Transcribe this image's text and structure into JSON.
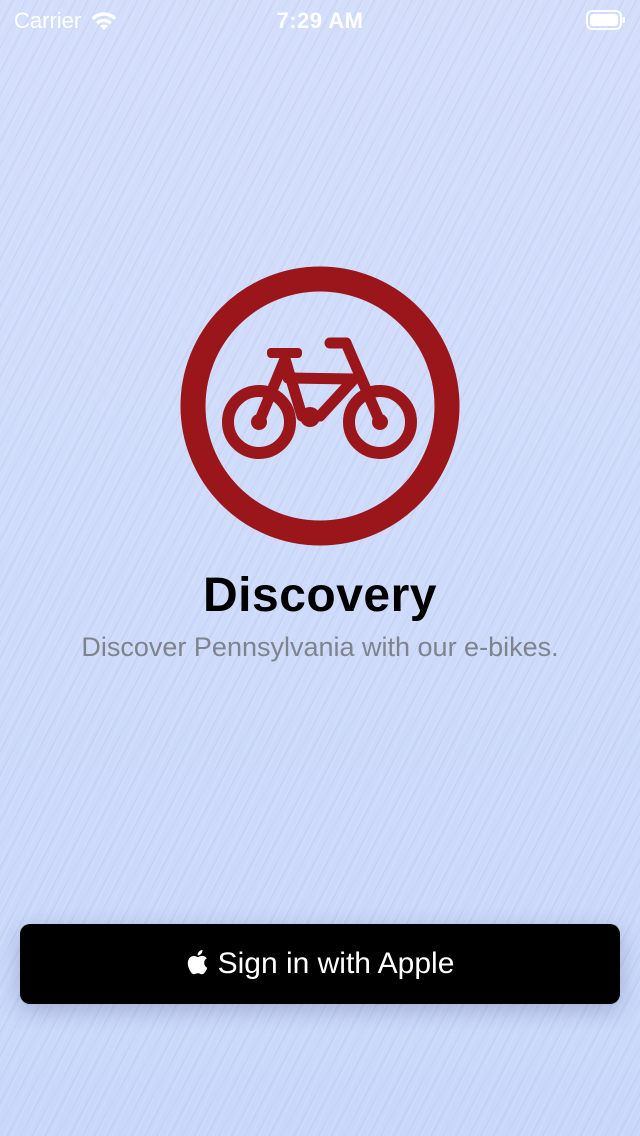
{
  "status_bar": {
    "carrier": "Carrier",
    "time": "7:29 AM",
    "icons": [
      "wifi-icon",
      "battery-icon"
    ]
  },
  "logo": {
    "icon": "bicycle-icon",
    "color": "#9a161b"
  },
  "app": {
    "title": "Discovery",
    "subtitle": "Discover Pennsylvania with our e-bikes."
  },
  "signin": {
    "label": "Sign in with Apple",
    "icon": "apple-icon"
  },
  "colors": {
    "background": "#cfdcfb",
    "accent": "#9a161b",
    "button": "#000000",
    "subtitle": "#7e838d"
  }
}
